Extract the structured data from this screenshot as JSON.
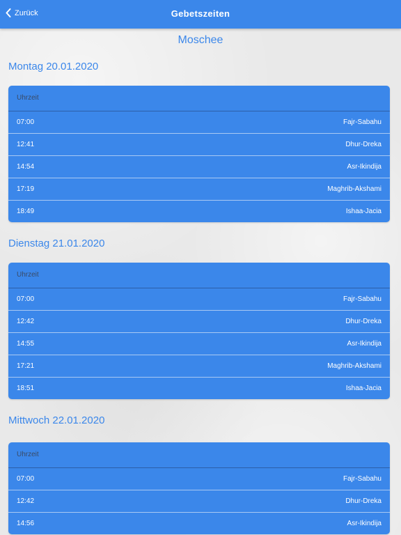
{
  "nav": {
    "back_label": "Zurück",
    "title": "Gebetszeiten"
  },
  "mosque_name": "Moschee",
  "days": [
    {
      "date_label": "Montag 20.01.2020",
      "header": "Uhrzeit",
      "prayers": [
        {
          "time": "07:00",
          "name": "Fajr-Sabahu"
        },
        {
          "time": "12:41",
          "name": "Dhur-Dreka"
        },
        {
          "time": "14:54",
          "name": "Asr-Ikindija"
        },
        {
          "time": "17:19",
          "name": "Maghrib-Akshami"
        },
        {
          "time": "18:49",
          "name": "Ishaa-Jacia"
        }
      ]
    },
    {
      "date_label": "Dienstag 21.01.2020",
      "header": "Uhrzeit",
      "prayers": [
        {
          "time": "07:00",
          "name": "Fajr-Sabahu"
        },
        {
          "time": "12:42",
          "name": "Dhur-Dreka"
        },
        {
          "time": "14:55",
          "name": "Asr-Ikindija"
        },
        {
          "time": "17:21",
          "name": "Maghrib-Akshami"
        },
        {
          "time": "18:51",
          "name": "Ishaa-Jacia"
        }
      ]
    },
    {
      "date_label": "Mittwoch 22.01.2020",
      "header": "Uhrzeit",
      "prayers": [
        {
          "time": "07:00",
          "name": "Fajr-Sabahu"
        },
        {
          "time": "12:42",
          "name": "Dhur-Dreka"
        },
        {
          "time": "14:56",
          "name": "Asr-Ikindija"
        }
      ]
    }
  ],
  "colors": {
    "primary": "#3b87ea",
    "header_text": "#3a4a66",
    "background": "#e9e9e9"
  }
}
